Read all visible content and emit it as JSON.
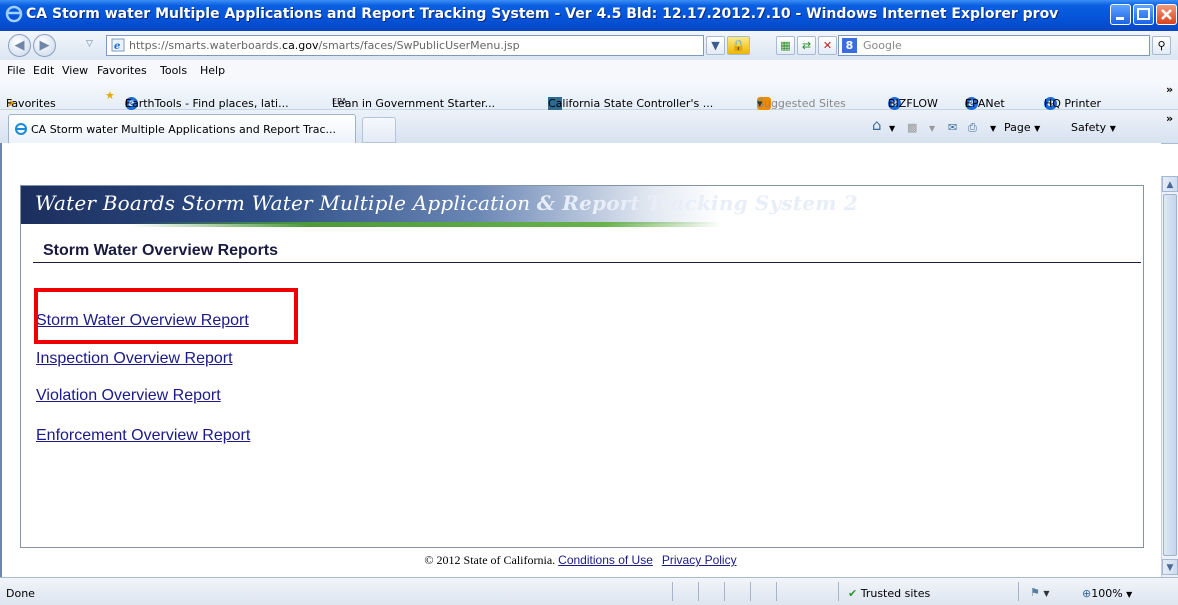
{
  "window": {
    "title": "CA Storm water Multiple Applications and Report Tracking System - Ver 4.5 Bld: 12.17.2012.7.10 - Windows Internet Explorer prov"
  },
  "address": {
    "prefix": "https://smarts.waterboards.",
    "domain": "ca.gov",
    "path": "/smarts/faces/SwPublicUserMenu.jsp",
    "search_placeholder": "Google"
  },
  "menu": [
    "File",
    "Edit",
    "View",
    "Favorites",
    "Tools",
    "Help"
  ],
  "favorites": {
    "label": "Favorites",
    "items": [
      "EarthTools - Find places, lati...",
      "Lean in Government Starter...",
      "California State Controller's ...",
      "Suggested Sites",
      "BIZFLOW",
      "EPANet",
      "HQ Printer"
    ]
  },
  "tabs": {
    "active": "CA Storm water Multiple Applications and Report Trac...",
    "page_menu": "Page",
    "safety_menu": "Safety"
  },
  "banner": {
    "part1": "Water Boards  Storm Water Multiple Application ",
    "part2": "& Report Tracking System 2"
  },
  "page": {
    "heading": "Storm Water Overview Reports",
    "links": [
      "Storm Water Overview Report",
      "Inspection Overview Report",
      "Violation Overview Report",
      "Enforcement Overview Report"
    ]
  },
  "footer": {
    "copyright": "© 2012 State of California.",
    "conditions": "Conditions of Use",
    "privacy": "Privacy Policy"
  },
  "status": {
    "text": "Done",
    "zone": "Trusted sites",
    "zoom": "100%"
  },
  "colors": {
    "highlight": "#ee0000",
    "link": "#1a1a8a",
    "titlebar": "#0553d8"
  }
}
